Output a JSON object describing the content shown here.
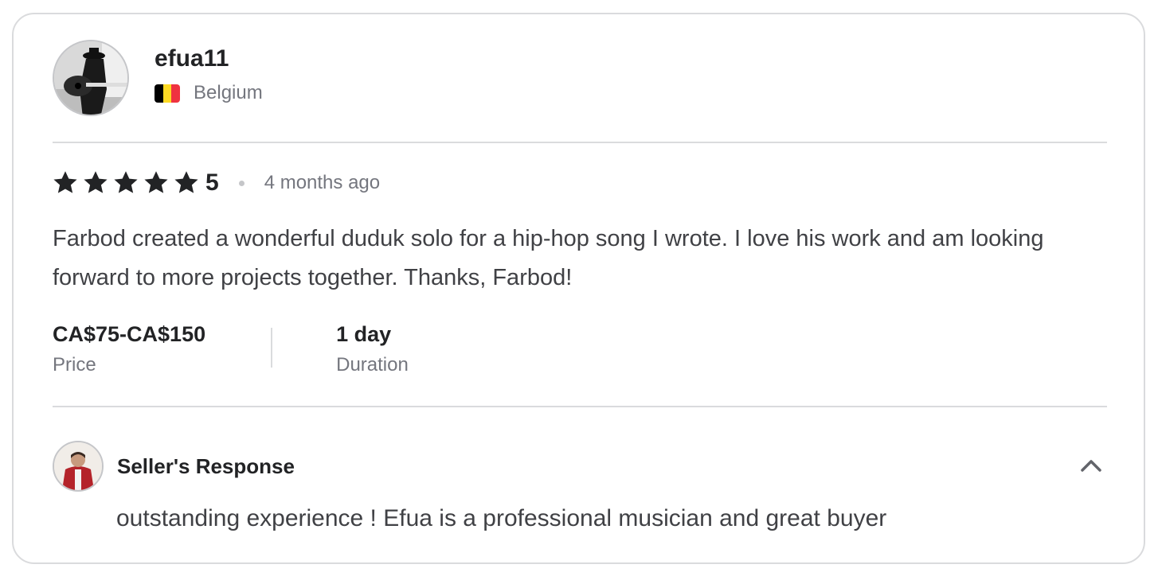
{
  "reviewer": {
    "username": "efua11",
    "country": "Belgium",
    "flag_colors": [
      "#000000",
      "#FDDA24",
      "#EF3340"
    ],
    "avatar": "guitarist-avatar"
  },
  "rating": {
    "stars": 5,
    "value": "5",
    "time": "4 months ago",
    "star_color": "#222325"
  },
  "review": {
    "text": "Farbod created a wonderful duduk solo for a hip-hop song I wrote. I love his work and am looking forward to more projects together. Thanks, Farbod!"
  },
  "meta": {
    "price_value": "CA$75-CA$150",
    "price_label": "Price",
    "duration_value": "1 day",
    "duration_label": "Duration"
  },
  "seller_response": {
    "title": "Seller's Response",
    "text": "outstanding experience ! Efua is a professional musician and great buyer",
    "avatar": "seller-avatar",
    "toggle_icon": "chevron-up-icon"
  }
}
